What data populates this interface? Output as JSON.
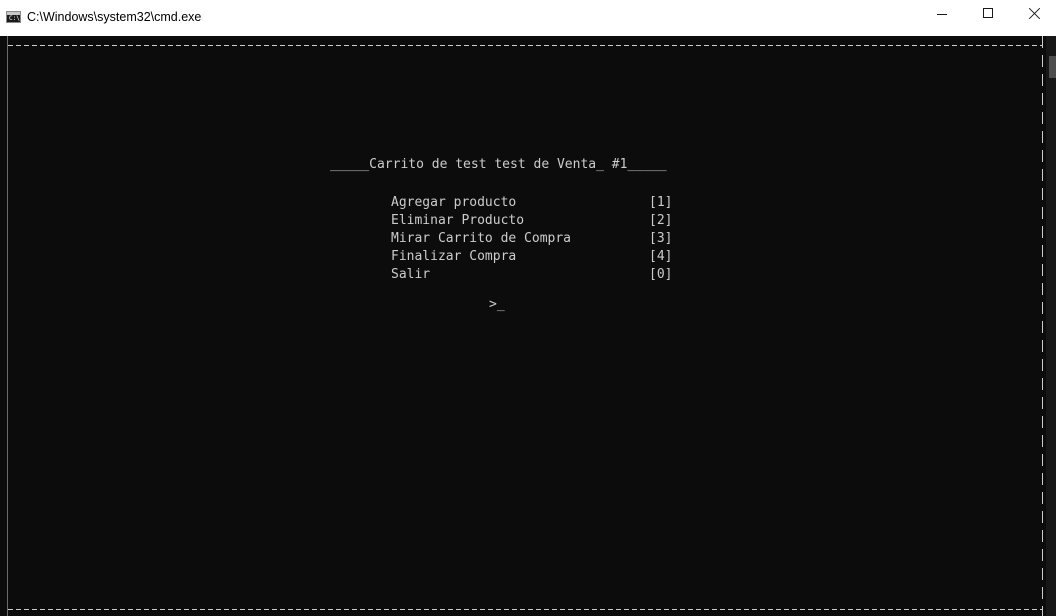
{
  "window": {
    "title": "C:\\Windows\\system32\\cmd.exe",
    "icon": "cmd-console-icon",
    "icon_glyph": "C:\\",
    "controls": {
      "minimize": "minimize-icon",
      "maximize": "maximize-icon",
      "close": "close-icon"
    }
  },
  "console": {
    "background": "#0c0c0c",
    "foreground": "#cccccc",
    "menu_title": "_____Carrito de test test de Venta_ #1_____",
    "menu_items": [
      {
        "label": "Agregar producto",
        "key": "[1]"
      },
      {
        "label": "Eliminar Producto",
        "key": "[2]"
      },
      {
        "label": "Mirar Carrito de Compra",
        "key": "[3]"
      },
      {
        "label": "Finalizar Compra",
        "key": "[4]"
      },
      {
        "label": "Salir",
        "key": "[0]"
      }
    ],
    "prompt": ">_"
  }
}
